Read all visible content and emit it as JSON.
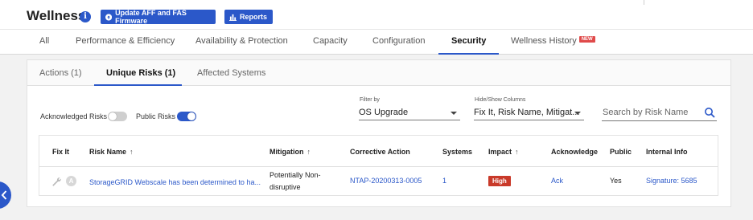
{
  "header": {
    "title": "Wellness",
    "info_glyph": "i",
    "update_button": "Update AFF and FAS Firmware",
    "reports_button": "Reports"
  },
  "tabs": [
    {
      "label": "All"
    },
    {
      "label": "Performance & Efficiency"
    },
    {
      "label": "Availability & Protection"
    },
    {
      "label": "Capacity"
    },
    {
      "label": "Configuration"
    },
    {
      "label": "Security",
      "active": true
    },
    {
      "label": "Wellness History",
      "badge": "NEW"
    }
  ],
  "subtabs": [
    {
      "label": "Actions (1)"
    },
    {
      "label": "Unique Risks (1)",
      "active": true
    },
    {
      "label": "Affected Systems"
    }
  ],
  "filters": {
    "acknowledged_label": "Acknowledged Risks",
    "acknowledged_on": false,
    "public_label": "Public Risks",
    "public_on": true,
    "filter_by_label": "Filter by",
    "filter_by_value": "OS Upgrade",
    "columns_label": "Hide/Show Columns",
    "columns_value": "Fix It, Risk Name, Mitigat...",
    "search_placeholder": "Search by Risk Name"
  },
  "table": {
    "headers": [
      "Fix It",
      "Risk Name",
      "Mitigation",
      "Corrective Action",
      "Systems",
      "Impact",
      "Acknowledge",
      "Public",
      "Internal Info"
    ],
    "sort_glyph": "↑",
    "rows": [
      {
        "fix_it_letter": "A",
        "risk_name": "StorageGRID Webscale has been determined to ha...",
        "mitigation_line1": "Potentially Non-",
        "mitigation_line2": "disruptive",
        "corrective_action": "NTAP-20200313-0005",
        "systems": "1",
        "impact": "High",
        "acknowledge": "Ack",
        "public": "Yes",
        "internal_info": "Signature: 5685"
      }
    ]
  },
  "colors": {
    "accent": "#2b58c9",
    "badge_red": "#c93a2a",
    "new_badge": "#e04a4a"
  },
  "icons": [
    "info-icon",
    "upload-icon",
    "bar-chart-icon",
    "search-icon",
    "wrench-icon",
    "caret-down-icon",
    "chevron-left-icon",
    "sort-arrow-icon"
  ]
}
